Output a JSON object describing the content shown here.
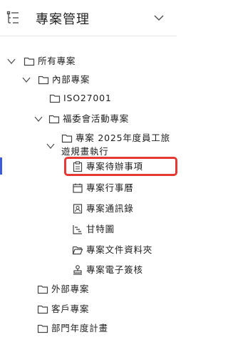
{
  "header": {
    "title": "專案管理",
    "menu_icon": "tree-list-icon",
    "toggle_icon": "chevron-down-icon"
  },
  "tree": {
    "root": "所有專案",
    "internal": "內部專案",
    "iso": "ISO27001",
    "welfare": "福委會活動專案",
    "project_line1": "專案 2025年度員工旅",
    "project_line2": "遊規畫執行",
    "items": {
      "todo": "專案待辦事項",
      "calendar": "專案行事曆",
      "contacts": "專案通訊錄",
      "gantt": "甘特圖",
      "files": "專案文件資料夾",
      "esign": "專案電子簽核"
    },
    "external": "外部專案",
    "customer": "客戶專案",
    "annual": "部門年度計畫"
  },
  "colors": {
    "highlight": "#e53935",
    "active_bar": "#3b5bdb",
    "icon": "#444444"
  }
}
